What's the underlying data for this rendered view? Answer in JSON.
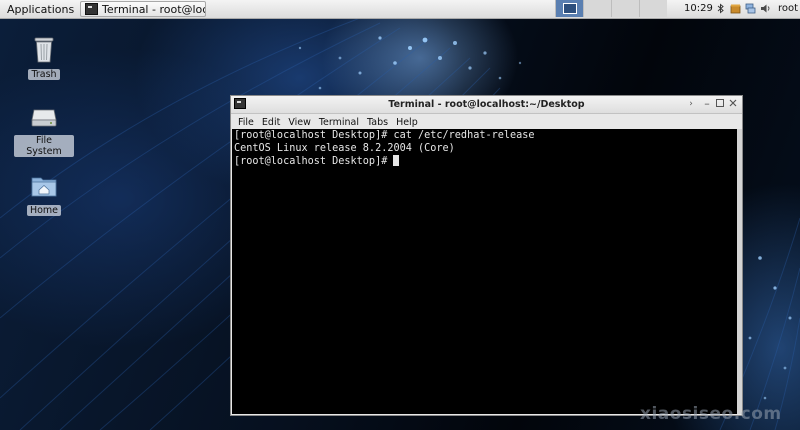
{
  "panel": {
    "applications_label": "Applications",
    "taskbar_item": "Terminal - root@localh...",
    "clock": "10:29",
    "user": "root"
  },
  "desktop": {
    "icons": [
      {
        "label": "Trash"
      },
      {
        "label": "File System"
      },
      {
        "label": "Home"
      }
    ]
  },
  "terminal": {
    "title": "Terminal - root@localhost:~/Desktop",
    "menu": [
      "File",
      "Edit",
      "View",
      "Terminal",
      "Tabs",
      "Help"
    ],
    "lines": [
      "[root@localhost Desktop]# cat /etc/redhat-release",
      "CentOS Linux release 8.2.2004 (Core)",
      "[root@localhost Desktop]# "
    ]
  },
  "watermark": "xiaosiseo.com",
  "colors": {
    "terminal_bg": "#000000",
    "terminal_fg": "#e6e6e6",
    "workspace_active": "#5a7fb1"
  }
}
